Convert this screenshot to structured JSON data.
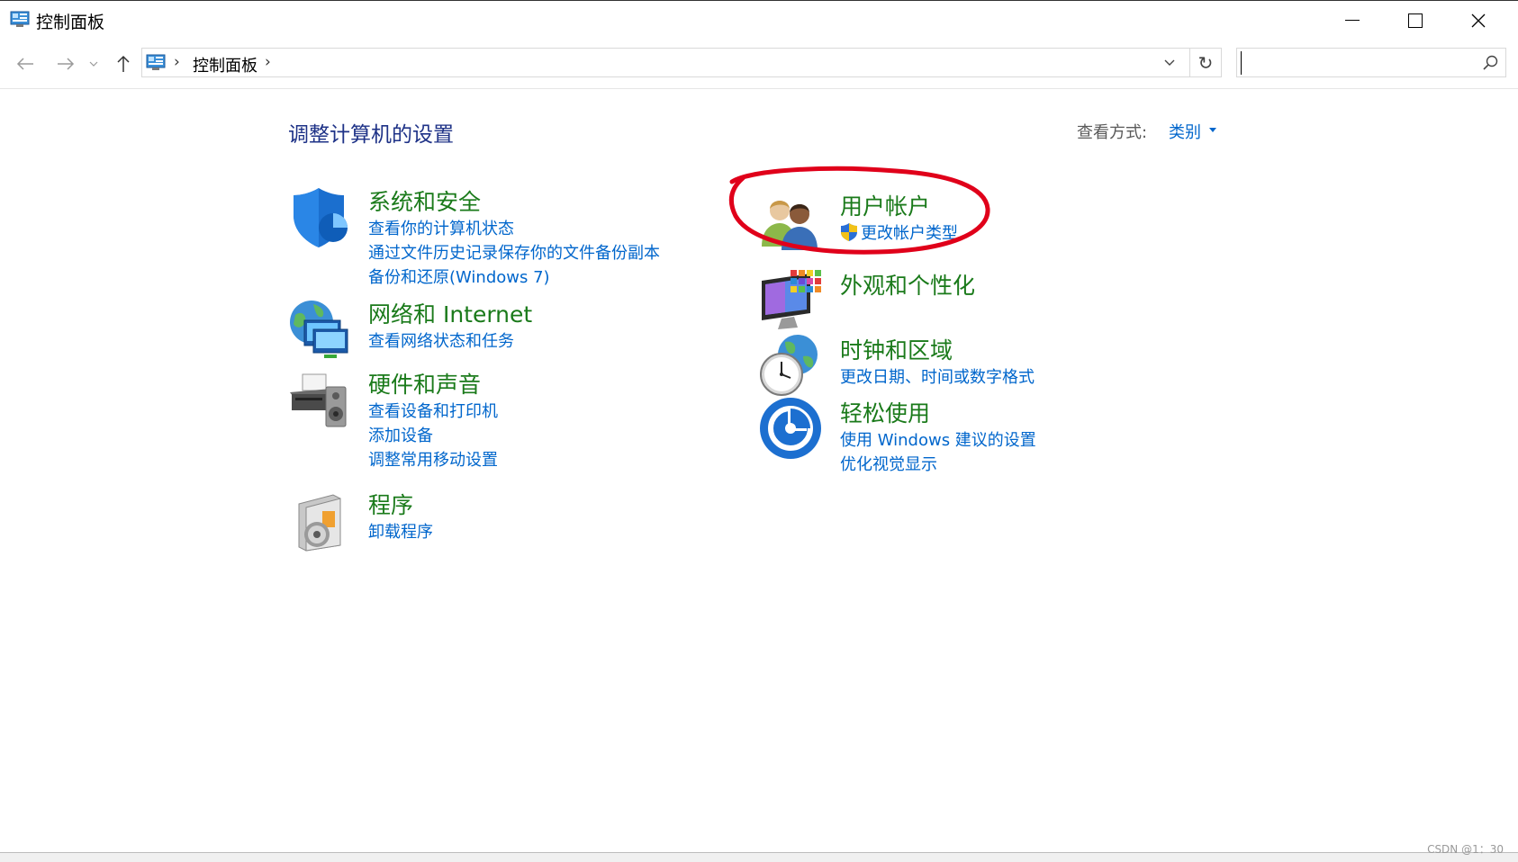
{
  "window": {
    "title": "控制面板"
  },
  "address": {
    "crumb": "控制面板",
    "search_placeholder": ""
  },
  "main": {
    "heading": "调整计算机的设置",
    "view_by_label": "查看方式:",
    "view_by_value": "类别"
  },
  "categories": [
    {
      "title": "系统和安全",
      "icon": "shield-icon",
      "links": [
        "查看你的计算机状态",
        "通过文件历史记录保存你的文件备份副本",
        "备份和还原(Windows 7)"
      ]
    },
    {
      "title": "网络和 Internet",
      "icon": "network-globe-icon",
      "links": [
        "查看网络状态和任务"
      ]
    },
    {
      "title": "硬件和声音",
      "icon": "printer-speaker-icon",
      "links": [
        "查看设备和打印机",
        "添加设备",
        "调整常用移动设置"
      ]
    },
    {
      "title": "程序",
      "icon": "programs-disc-icon",
      "links": [
        "卸载程序"
      ]
    },
    {
      "title": "用户帐户",
      "icon": "users-icon",
      "links": [
        "更改帐户类型"
      ]
    },
    {
      "title": "外观和个性化",
      "icon": "monitor-palette-icon",
      "links": []
    },
    {
      "title": "时钟和区域",
      "icon": "clock-globe-icon",
      "links": [
        "更改日期、时间或数字格式"
      ]
    },
    {
      "title": "轻松使用",
      "icon": "ease-of-access-icon",
      "links": [
        "使用 Windows 建议的设置",
        "优化视觉显示"
      ]
    }
  ],
  "colors": {
    "category_title": "#1a7a1a",
    "link": "#0066cc",
    "heading": "#1e3287",
    "annotation": "#e0001a"
  },
  "watermark": "CSDN @1：30"
}
